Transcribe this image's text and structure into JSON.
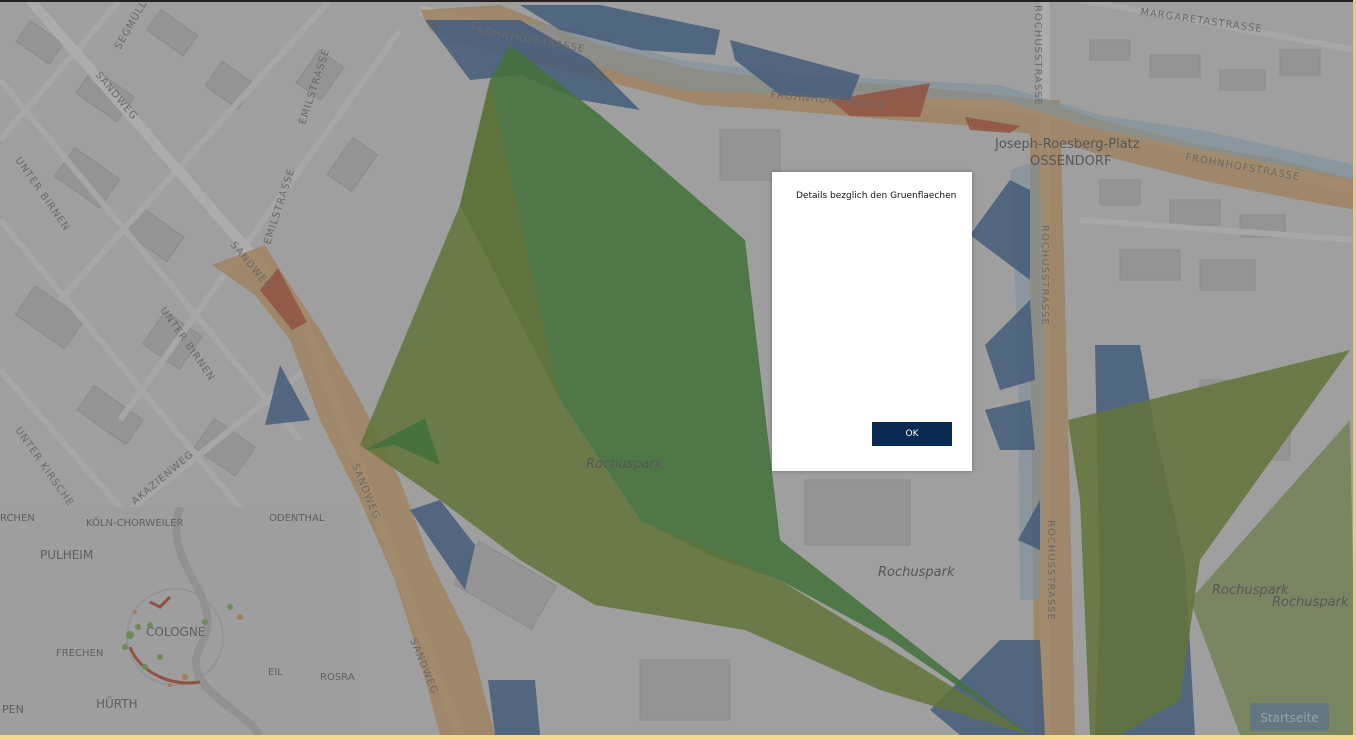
{
  "map": {
    "streets": {
      "margaretastrasse": "MARGARETASTRASSE",
      "frohnhofstrasse_1": "FROHNHOFSTRASSE",
      "frohnhofstrasse_2": "FROHNHOFSTRASSE",
      "frohnhofstrasse_3": "FROHNHOFSTRASSE",
      "rochusstrasse_1": "ROCHUSSTRASSE",
      "rochusstrasse_2": "ROCHUSSTRASSE",
      "rochusstrasse_3": "ROCHUSSTRASSE",
      "sandweg_1": "SANDWEG",
      "sandweg_2": "SANDWEG",
      "sandweg_3": "SANDWEG",
      "sandweg_4": "SANDWEG",
      "segmuller": "SEGMÜLL",
      "emilstrasse_1": "EMILSTRASSE",
      "emilstrasse_2": "EMILSTRASSE",
      "unter_birnen_1": "UNTER BIRNEN",
      "unter_birnen_2": "UNTER BIRNEN",
      "unter_kirschen": "UNTER KIRSCHE",
      "akazienweg": "AKAZIENWEG"
    },
    "places": {
      "joseph_roesberg_platz": "Joseph-Roesberg-Platz",
      "bossendorf": "OSSENDORF",
      "rochuspark_1": "Rochuspark",
      "rochuspark_2": "Rochuspark",
      "rochuspark_3": "Rochuspark",
      "rochuspark_4": "Rochuspark"
    },
    "colors": {
      "green_area": "#2f8a1e",
      "olive_area": "#6b8e1a",
      "blue_area": "#2f5f9a",
      "orange_route": "#e3a657",
      "red_segment": "#c84b2a",
      "lightblue_route": "#9cc9e0"
    }
  },
  "minimap": {
    "labels": {
      "rchen": "RCHEN",
      "koln_chorweiler": "KÖLN-CHORWEILER",
      "odenthal": "ODENTHAL",
      "pulheim": "PULHEIM",
      "cologne": "COLOGNE",
      "frechen": "FRECHEN",
      "eil": "EIL",
      "rosra": "ROSRA",
      "hurth": "HÜRTH",
      "pen": "PEN"
    }
  },
  "home_button": {
    "label": "Startseite"
  },
  "dialog": {
    "title": "Details bezglich den Gruenflaechen",
    "ok_label": "OK"
  }
}
